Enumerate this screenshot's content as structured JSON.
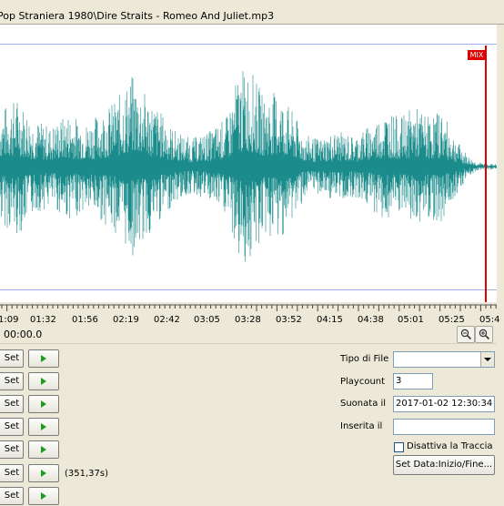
{
  "file": {
    "path": "Pop Straniera 1980\\Dire Straits - Romeo And Juliet.mp3"
  },
  "waveform": {
    "color": "#1b8b8b",
    "guide_color": "#9fb0e8",
    "mix_label": "MIX",
    "mix_color": "#e00000"
  },
  "timeline": {
    "labels": [
      "1:09",
      "01:32",
      "01:56",
      "02:19",
      "02:42",
      "03:05",
      "03:28",
      "03:52",
      "04:15",
      "04:38",
      "05:01",
      "05:25",
      "05:4"
    ]
  },
  "position": {
    "time": "00:00.0"
  },
  "zoom": {
    "out_icon": "zoom-out-icon",
    "in_icon": "zoom-in-icon"
  },
  "cue_rows": {
    "set_label": "Set",
    "play_icon": "play-icon",
    "duration": "(351,37s)"
  },
  "info": {
    "tipo_label": "Tipo di File",
    "tipo_value": "",
    "playcount_label": "Playcount",
    "playcount_value": "3",
    "suonata_label": "Suonata il",
    "suonata_value": "2017-01-02 12:30:34",
    "inserita_label": "Inserita il",
    "inserita_value": "",
    "disattiva_label": "Disattiva la Traccia",
    "disattiva_checked": false,
    "setdata_label": "Set Data:Inizio/Fine..."
  }
}
